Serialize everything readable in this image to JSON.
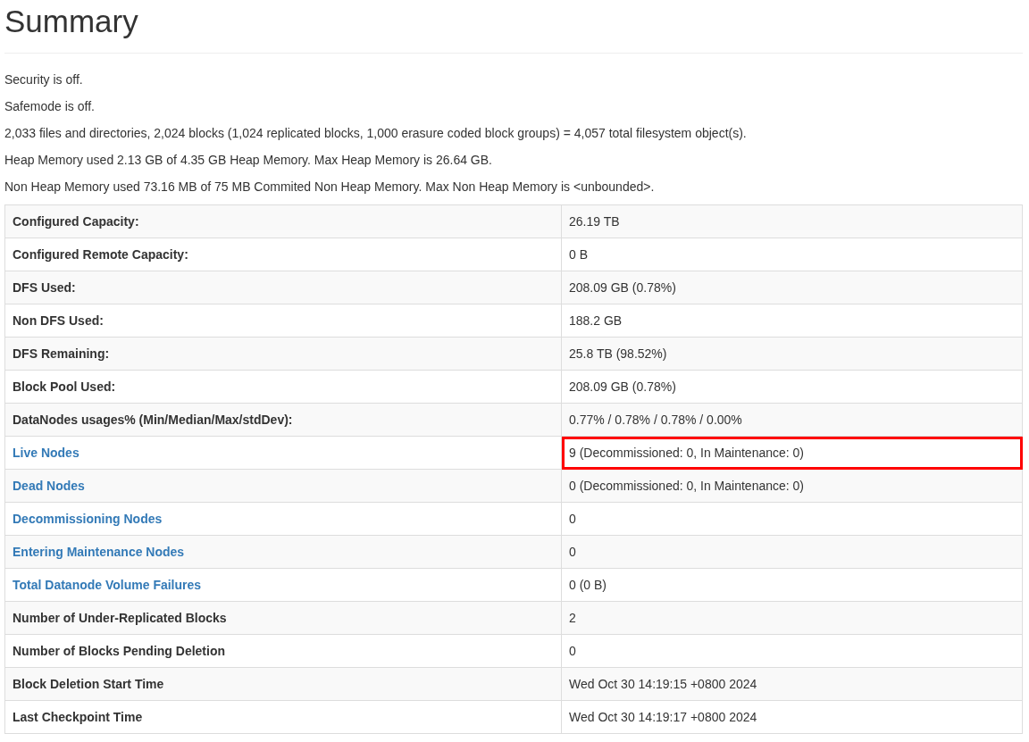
{
  "title": "Summary",
  "lines": [
    "Security is off.",
    "Safemode is off.",
    "2,033 files and directories, 2,024 blocks (1,024 replicated blocks, 1,000 erasure coded block groups) = 4,057 total filesystem object(s).",
    "Heap Memory used 2.13 GB of 4.35 GB Heap Memory. Max Heap Memory is 26.64 GB.",
    "Non Heap Memory used 73.16 MB of 75 MB Commited Non Heap Memory. Max Non Heap Memory is <unbounded>."
  ],
  "table": {
    "rows": [
      {
        "kind": "text",
        "label": "Configured Capacity:",
        "value": "26.19 TB",
        "highlighted": false
      },
      {
        "kind": "text",
        "label": "Configured Remote Capacity:",
        "value": "0 B",
        "highlighted": false
      },
      {
        "kind": "text",
        "label": "DFS Used:",
        "value": "208.09 GB (0.78%)",
        "highlighted": false
      },
      {
        "kind": "text",
        "label": "Non DFS Used:",
        "value": "188.2 GB",
        "highlighted": false
      },
      {
        "kind": "text",
        "label": "DFS Remaining:",
        "value": "25.8 TB (98.52%)",
        "highlighted": false
      },
      {
        "kind": "text",
        "label": "Block Pool Used:",
        "value": "208.09 GB (0.78%)",
        "highlighted": false
      },
      {
        "kind": "text",
        "label": "DataNodes usages% (Min/Median/Max/stdDev):",
        "value": "0.77% / 0.78% / 0.78% / 0.00%",
        "highlighted": false
      },
      {
        "kind": "link",
        "label": "Live Nodes",
        "value": "9 (Decommissioned: 0, In Maintenance: 0)",
        "highlighted": true
      },
      {
        "kind": "link",
        "label": "Dead Nodes",
        "value": "0 (Decommissioned: 0, In Maintenance: 0)",
        "highlighted": false
      },
      {
        "kind": "link",
        "label": "Decommissioning Nodes",
        "value": "0",
        "highlighted": false
      },
      {
        "kind": "link",
        "label": "Entering Maintenance Nodes",
        "value": "0",
        "highlighted": false
      },
      {
        "kind": "link",
        "label": "Total Datanode Volume Failures",
        "value": "0 (0 B)",
        "highlighted": false
      },
      {
        "kind": "text",
        "label": "Number of Under-Replicated Blocks",
        "value": "2",
        "highlighted": false
      },
      {
        "kind": "text",
        "label": "Number of Blocks Pending Deletion",
        "value": "0",
        "highlighted": false
      },
      {
        "kind": "text",
        "label": "Block Deletion Start Time",
        "value": "Wed Oct 30 14:19:15 +0800 2024",
        "highlighted": false
      },
      {
        "kind": "text",
        "label": "Last Checkpoint Time",
        "value": "Wed Oct 30 14:19:17 +0800 2024",
        "highlighted": false
      }
    ]
  }
}
